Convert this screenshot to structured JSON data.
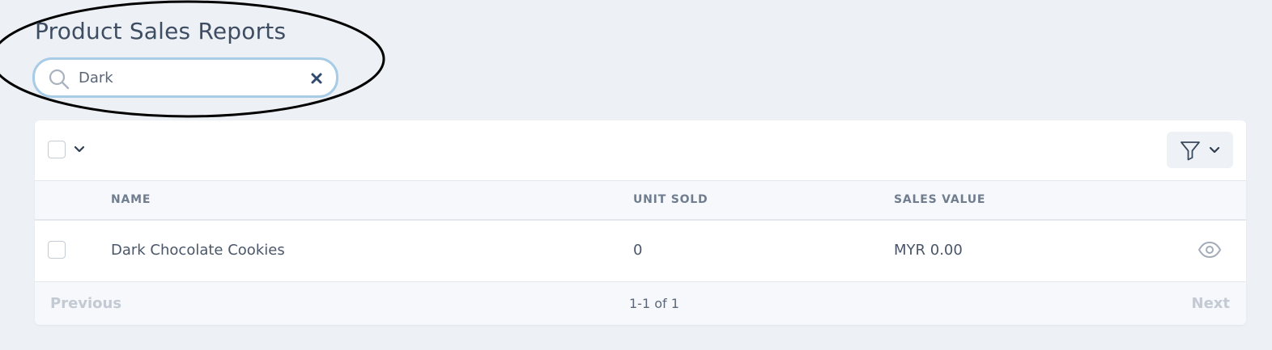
{
  "header": {
    "title": "Product Sales Reports"
  },
  "search": {
    "value": "Dark",
    "search_icon": "search-icon",
    "clear_icon": "close-icon"
  },
  "toolbar": {
    "select_all_icon": "chevron-down-icon",
    "filter_icon": "filter-icon"
  },
  "table": {
    "columns": [
      "NAME",
      "UNIT SOLD",
      "SALES VALUE"
    ],
    "rows": [
      {
        "name": "Dark Chocolate Cookies",
        "units_sold": "0",
        "sales_value": "MYR 0.00",
        "action_icon": "eye-icon"
      }
    ]
  },
  "pagination": {
    "previous_label": "Previous",
    "page_info": "1-1 of 1",
    "next_label": "Next"
  },
  "colors": {
    "background": "#edf1f5",
    "search_focus_border": "#a8cbe6",
    "text_primary": "#3f4d63",
    "disabled_link": "#c3cad4",
    "annotation": "#000000"
  }
}
